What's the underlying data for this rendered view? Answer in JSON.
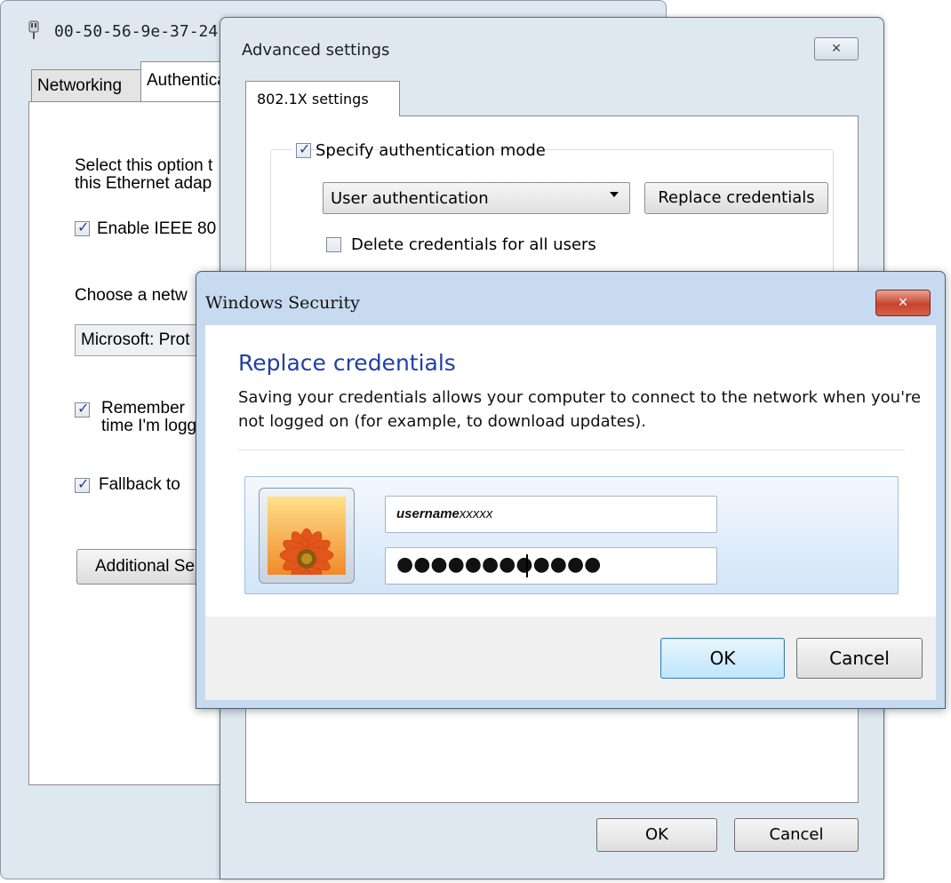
{
  "props_window": {
    "title": "00-50-56-9e-37-24",
    "tabs": [
      "Networking",
      "Authentication"
    ],
    "text_select_line1": "Select this option t",
    "text_select_line2": "this Ethernet adap",
    "enable_ieee_label": "Enable IEEE 80",
    "enable_ieee_checked": true,
    "choose_method_label": "Choose a netw",
    "method_value": "Microsoft: Prot",
    "remember_label_line1": "Remember",
    "remember_label_line2": "time I'm logg",
    "remember_checked": true,
    "fallback_label": "Fallback to",
    "fallback_checked": true,
    "additional_button": "Additional Se",
    "icon": "network-adapter-icon"
  },
  "adv_window": {
    "title": "Advanced settings",
    "close_glyph": "✕",
    "tab": "802.1X settings",
    "specify_auth_label": "Specify authentication mode",
    "specify_auth_checked": true,
    "auth_mode_value": "User authentication",
    "replace_button": "Replace credentials",
    "delete_credentials_label": "Delete credentials for all users",
    "delete_credentials_checked": false,
    "ok_button": "OK",
    "cancel_button": "Cancel"
  },
  "security_dialog": {
    "title": "Windows Security",
    "close_glyph": "✕",
    "heading": "Replace credentials",
    "description": "Saving your credentials allows your computer to connect to the network when you're not logged on (for example, to download updates).",
    "username_bold": "username",
    "username_rest": "xxxxx",
    "password_mask": "●●●●●●●●●●●●",
    "ok_button": "OK",
    "cancel_button": "Cancel",
    "user_tile_icon": "flower-user-picture-icon",
    "accent_color": "#1f3fa6",
    "close_button_color": "#c8432e"
  }
}
